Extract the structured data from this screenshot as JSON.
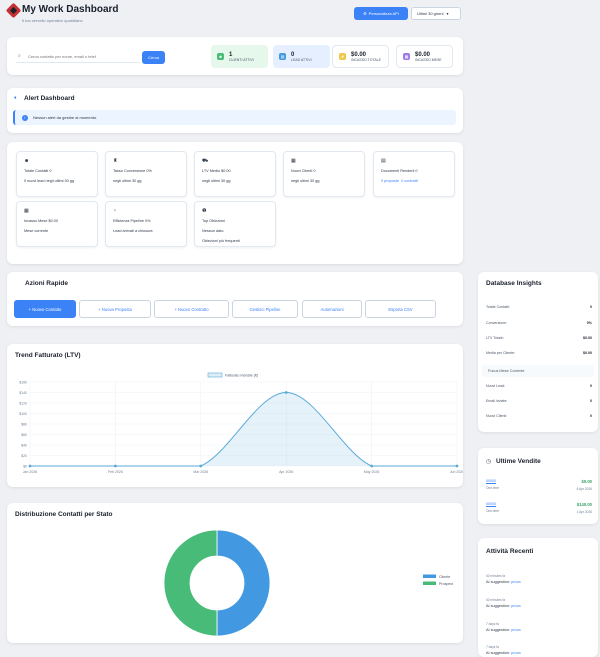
{
  "header": {
    "title": "My Work Dashboard",
    "subtitle": "Il tuo cervello operativo quotidiano",
    "api_button": "Personalizza API",
    "period_select": "Ultimi 30 giorni"
  },
  "search": {
    "placeholder": "Cerca contatto per nome, email o telef",
    "button": "Cerca"
  },
  "stats": [
    {
      "value": "1",
      "label": "CLIENTI ATTIVI",
      "color": "#48bb78",
      "bg": "#e6f7ec"
    },
    {
      "value": "0",
      "label": "LEAD ATTIVI",
      "color": "#4299e1",
      "bg": "#e5efff"
    },
    {
      "value": "$0.00",
      "label": "INCASSO TOTALE",
      "color": "#ecc94b",
      "bg": "#ffffff"
    },
    {
      "value": "$0.00",
      "label": "INCASSO MESE",
      "color": "#9f7aea",
      "bg": "#ffffff"
    }
  ],
  "alerts": {
    "title": "Alert Dashboard",
    "message": "Nessun alert da gestire al momento."
  },
  "metrics": [
    {
      "icon": "users-icon",
      "glyph": "☻",
      "title": "Totale Contatti 0",
      "line1": "0 nuovi lead negli ultimi 30 gg"
    },
    {
      "icon": "user-tie-icon",
      "glyph": "♜",
      "title": "Tasso Conversione 0%",
      "line1": "negli ultimi 30 gg"
    },
    {
      "icon": "cart-icon",
      "glyph": "⛟",
      "title": "LTV Medio $0.00",
      "line1": "negli ultimi 30 gg"
    },
    {
      "icon": "calendar-icon",
      "glyph": "▦",
      "title": "Nuovi Clienti 0",
      "line1": "negli ultimi 30 gg"
    },
    {
      "icon": "document-icon",
      "glyph": "▤",
      "title": "Documenti Renderli 0",
      "line1": "0 proposte",
      "line1b": "0 contratti"
    },
    {
      "icon": "calendar-icon",
      "glyph": "▦",
      "title": "Incasso Mese $0.00",
      "line1": "Mese corrente"
    },
    {
      "icon": "pie-icon",
      "glyph": "◔",
      "title": "Efficienza Pipeline 0%",
      "line1": "Lead arrivati a chiusura"
    },
    {
      "icon": "info-icon",
      "glyph": "❶",
      "title": "Top Obiezioni",
      "line1": "Nessun dato.",
      "line2": "Obiezioni più frequenti"
    }
  ],
  "quick_actions": {
    "title": "Azioni Rapide",
    "buttons": [
      "+ Nuovo Contatto",
      "+ Nuova Proposta",
      "+ Nuovo Contratto",
      "Gestisci Pipeline",
      "Automazioni",
      "Esporta CSV"
    ]
  },
  "trend": {
    "title": "Trend Fatturato (LTV)"
  },
  "chart_data": [
    {
      "type": "area",
      "title": "Trend Fatturato (LTV)",
      "series": [
        {
          "name": "Fatturato mensile (€)",
          "values": [
            0,
            0,
            0,
            140,
            0,
            0
          ]
        }
      ],
      "x": [
        "Jan 2026",
        "Feb 2026",
        "Mar 2026",
        "Apr 2026",
        "May 2026",
        "Jun 2026"
      ],
      "y_ticks": [
        "$0",
        "$20",
        "$40",
        "$60",
        "$80",
        "$100",
        "$120",
        "$140",
        "$160"
      ],
      "ylim": [
        0,
        160
      ],
      "grid": true,
      "legend": "top",
      "color": "#5aa9d8"
    },
    {
      "type": "pie",
      "title": "Distribuzione Contatti per Stato",
      "categories": [
        "Cliente",
        "Prospect"
      ],
      "values": [
        1,
        1
      ],
      "colors": [
        "#4299e1",
        "#48bb78"
      ],
      "legend": "right"
    }
  ],
  "donut": {
    "title": "Distribuzione Contatti per Stato"
  },
  "insights": {
    "title": "Database Insights",
    "rows": [
      {
        "label": "Totale Contatti:",
        "value": "0"
      },
      {
        "label": "Conversione:",
        "value": "0%"
      },
      {
        "label": "LTV Totale:",
        "value": "$0.00"
      },
      {
        "label": "Media per Cliente:",
        "value": "$0.00"
      }
    ],
    "focus_title": "Focus Mese Corrente",
    "focus_rows": [
      {
        "label": "Nuovi Lead:",
        "value": "0"
      },
      {
        "label": "Email inviate:",
        "value": "0"
      },
      {
        "label": "Nuovi Clienti:",
        "value": "0"
      }
    ]
  },
  "sales": {
    "title": "Ultime Vendite",
    "items": [
      {
        "client": "00000",
        "amount": "$0.00",
        "freq": "One-time",
        "date": "6 Apr 2026"
      },
      {
        "client": "00000",
        "amount": "$140.00",
        "freq": "One-time",
        "date": "1 Apr 2026"
      }
    ]
  },
  "activity": {
    "title": "Attività Recenti",
    "items": [
      {
        "when": "40 minutes fa",
        "text": "AI suggestion:",
        "link": "prova"
      },
      {
        "when": "40 minutes fa",
        "text": "AI suggestion:",
        "link": "prova"
      },
      {
        "when": "7 days fa",
        "text": "AI suggestion:",
        "link": "prova"
      },
      {
        "when": "7 days fa",
        "text": "AI suggestion:",
        "link": "prova"
      }
    ]
  }
}
